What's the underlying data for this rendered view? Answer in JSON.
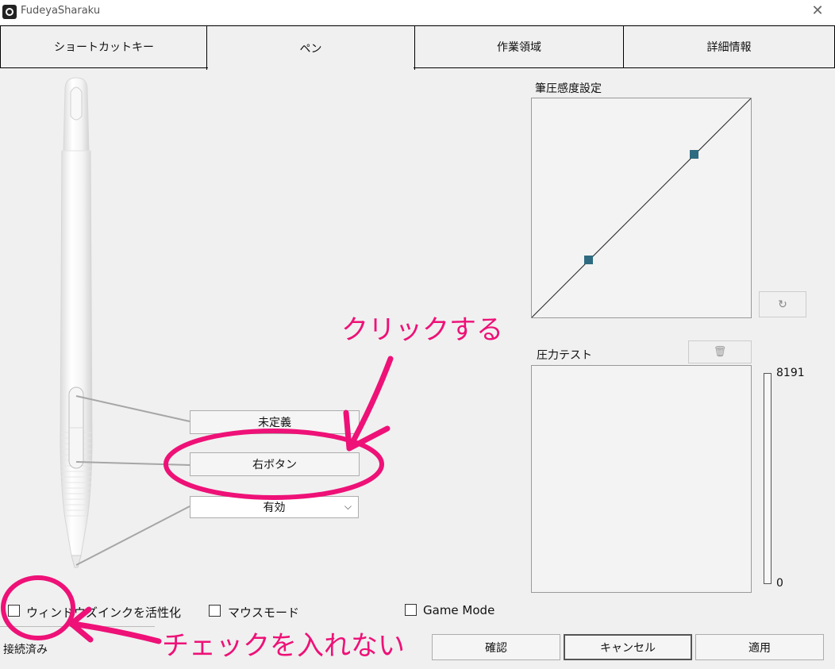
{
  "window": {
    "title": "FudeyaSharaku"
  },
  "tabs": [
    {
      "label": "ショートカットキー"
    },
    {
      "label": "ペン"
    },
    {
      "label": "作業領域"
    },
    {
      "label": "詳細情報"
    }
  ],
  "pen": {
    "upper_button": "未定義",
    "lower_button": "右ボタン",
    "tip_select": "有効"
  },
  "curve": {
    "title": "筆圧感度設定"
  },
  "pressure_test": {
    "title": "圧力テスト",
    "max": "8191",
    "min": "0"
  },
  "options": {
    "windows_ink": "ウィンドウズインクを活性化",
    "mouse_mode": "マウスモード",
    "game_mode": "Game Mode"
  },
  "status": {
    "text": "接続済み"
  },
  "buttons": {
    "confirm": "確認",
    "cancel": "キャンセル",
    "apply": "適用"
  },
  "annotations": {
    "click": "クリックする",
    "uncheck": "チェックを入れない",
    "color": "#ee1177"
  }
}
